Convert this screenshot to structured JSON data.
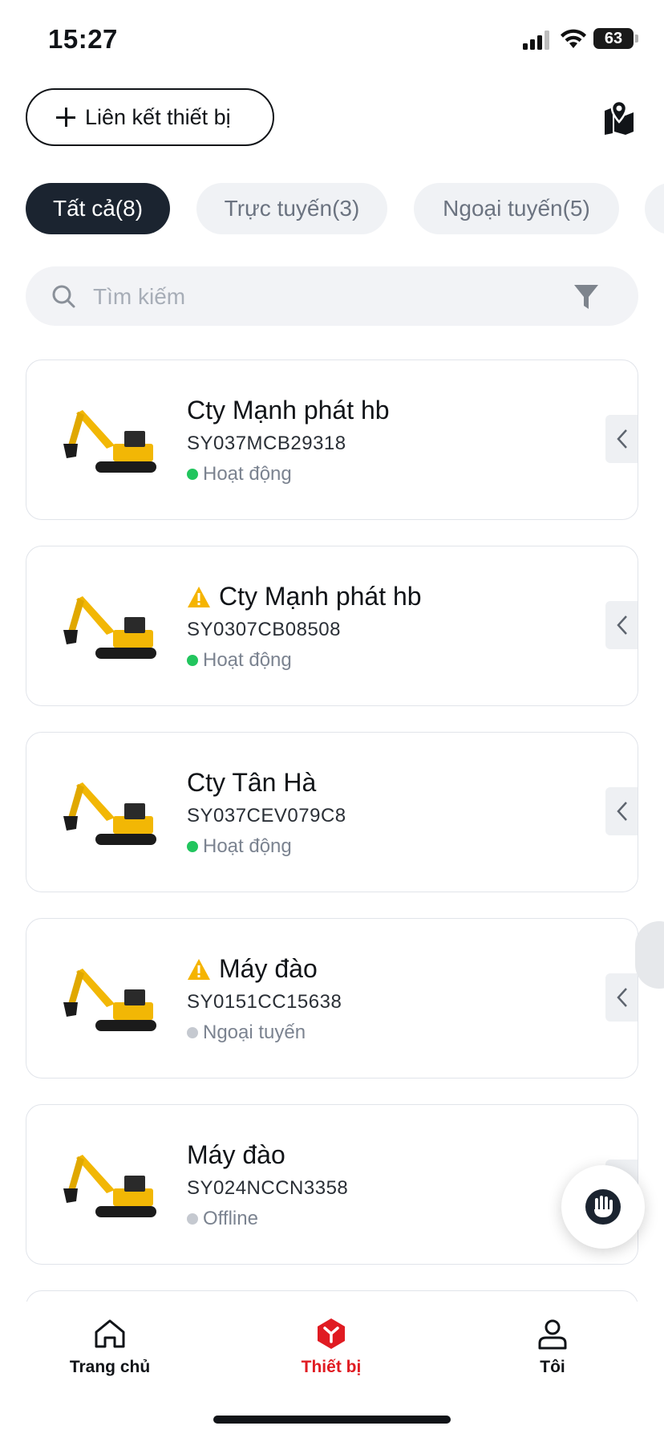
{
  "status_bar": {
    "time": "15:27",
    "battery": "63"
  },
  "header": {
    "link_device_label": "Liên kết thiết bị",
    "map_icon": "map-pin-icon"
  },
  "tabs": [
    {
      "label": "Tất cả(8)",
      "active": true
    },
    {
      "label": "Trực tuyến(3)",
      "active": false
    },
    {
      "label": "Ngoại tuyến(5)",
      "active": false
    }
  ],
  "search": {
    "placeholder": "Tìm kiếm",
    "value": ""
  },
  "devices": [
    {
      "name": "Cty Mạnh phát hb",
      "serial": "SY037MCB29318",
      "status": "Hoạt động",
      "status_color": "#22c55e",
      "warning": false
    },
    {
      "name": "Cty Mạnh phát hb",
      "serial": "SY0307CB08508",
      "status": "Hoạt động",
      "status_color": "#22c55e",
      "warning": true
    },
    {
      "name": "Cty Tân Hà",
      "serial": "SY037CEV079C8",
      "status": "Hoạt động",
      "status_color": "#22c55e",
      "warning": false
    },
    {
      "name": "Máy đào",
      "serial": "SY0151CC15638",
      "status": "Ngoại tuyến",
      "status_color": "#c5c9d0",
      "warning": true
    },
    {
      "name": "Máy đào",
      "serial": "SY024NCCN3358",
      "status": "Offline",
      "status_color": "#c5c9d0",
      "warning": false
    }
  ],
  "bottom_nav": [
    {
      "label": "Trang chủ",
      "icon": "home-icon",
      "active": false
    },
    {
      "label": "Thiết bị",
      "icon": "device-icon",
      "active": true
    },
    {
      "label": "Tôi",
      "icon": "user-icon",
      "active": false
    }
  ],
  "colors": {
    "accent": "#e01b22",
    "active_tab_bg": "#1b2430",
    "online": "#22c55e",
    "offline": "#c5c9d0",
    "warning": "#f5b400",
    "excavator_yellow": "#f2b705"
  }
}
